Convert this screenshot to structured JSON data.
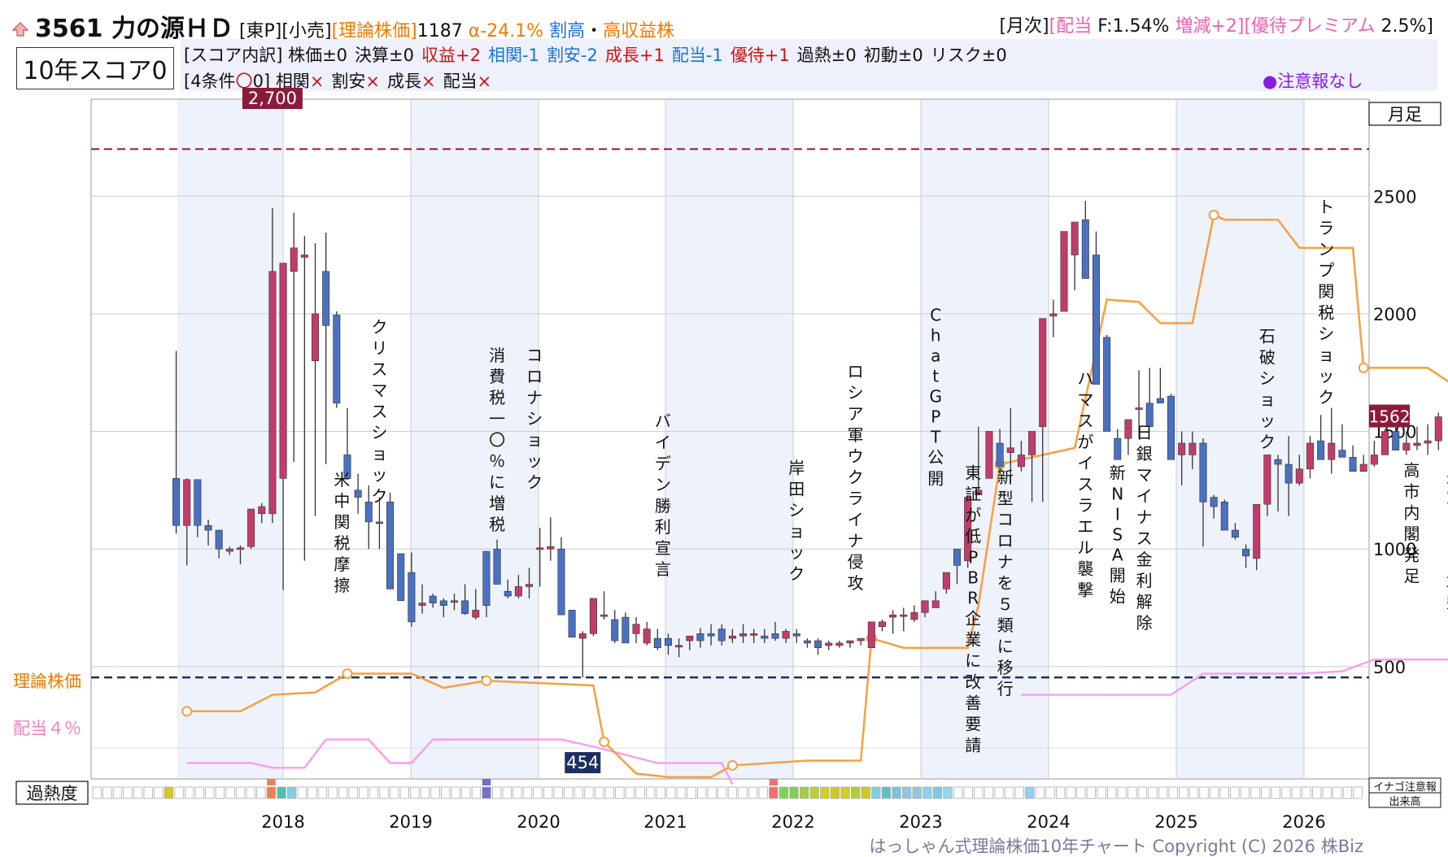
{
  "header": {
    "up_icon": "up-arrow-icon",
    "code_name": "3561 力の源ＨＤ",
    "market": "[東P][小売]",
    "theory_label": "[理論株価]",
    "theory_value": "1187",
    "alpha": "α-24.1%",
    "tag_overvalued": "割高",
    "tag_dot": "・",
    "tag_high_profit": "高収益株",
    "monthly": "[月次]",
    "div_label": "[配当",
    "div_value": "F:1.54%",
    "div_change": "増減+2]",
    "yutai_label": "[優待プレミアム",
    "yutai_value": "2.5%]"
  },
  "score": {
    "title": "10年スコア0",
    "breakdown_prefix": "[スコア内訳]",
    "items": [
      {
        "label": "株価±0",
        "color": "#111111"
      },
      {
        "label": "決算±0",
        "color": "#111111"
      },
      {
        "label": "収益+2",
        "color": "#d01010"
      },
      {
        "label": "相関-1",
        "color": "#1a73d6"
      },
      {
        "label": "割安-2",
        "color": "#1a73d6"
      },
      {
        "label": "成長+1",
        "color": "#d01010"
      },
      {
        "label": "配当-1",
        "color": "#1a73d6"
      },
      {
        "label": "優待+1",
        "color": "#d01010"
      },
      {
        "label": "過熱±0",
        "color": "#111111"
      },
      {
        "label": "初動±0",
        "color": "#111111"
      },
      {
        "label": "リスク±0",
        "color": "#111111"
      }
    ],
    "cond_prefix": "[4条件",
    "cond_circle": "〇",
    "cond_count": "0]",
    "conditions": [
      "相関",
      "割安",
      "成長",
      "配当"
    ],
    "cross": "×",
    "notice": "●注意報なし"
  },
  "chart_data": {
    "type": "candlestick",
    "period": "月足",
    "y_ticks": [
      500,
      1000,
      1500,
      2000,
      2500
    ],
    "x_ticks": [
      "2018",
      "2019",
      "2020",
      "2021",
      "2022",
      "2023",
      "2024",
      "2025",
      "2026"
    ],
    "high_label": "2,700",
    "low_label": "454",
    "last_label": "1562",
    "high_line": 2700,
    "low_line": 454,
    "series_labels": {
      "theory": "理論株価",
      "dividend": "配当４％"
    },
    "colors": {
      "up": "#c23c6a",
      "down": "#4a70c0",
      "theory": "#f5a040",
      "dividend": "#f7a0f0",
      "high_line": "#8b1a3a",
      "low_line": "#1c2f60"
    },
    "candles": [
      [
        1,
        1300,
        1842,
        1065,
        1100
      ],
      [
        2,
        1100,
        1300,
        930,
        1295
      ],
      [
        3,
        1295,
        1295,
        1050,
        1100
      ],
      [
        4,
        1100,
        1125,
        1015,
        1080
      ],
      [
        5,
        1080,
        1080,
        960,
        1000
      ],
      [
        6,
        990,
        1010,
        975,
        1000
      ],
      [
        7,
        1005,
        1015,
        935,
        1005
      ],
      [
        8,
        1010,
        1160,
        1000,
        1170
      ],
      [
        9,
        1150,
        1195,
        1110,
        1180
      ],
      [
        10,
        1150,
        2450,
        1110,
        2180
      ],
      [
        11,
        1300,
        2200,
        825,
        2215
      ],
      [
        12,
        2180,
        2430,
        1370,
        2280
      ],
      [
        13,
        2240,
        2330,
        950,
        2250
      ],
      [
        14,
        1800,
        2300,
        1140,
        2000
      ],
      [
        15,
        2180,
        2345,
        1360,
        1950
      ],
      [
        16,
        1995,
        2010,
        1600,
        1620
      ],
      [
        17,
        1400,
        1600,
        1400,
        1300
      ],
      [
        18,
        1250,
        1320,
        1150,
        1220
      ],
      [
        19,
        1200,
        1270,
        1000,
        1115
      ],
      [
        20,
        1115,
        1220,
        1000,
        1110
      ],
      [
        21,
        1200,
        1240,
        850,
        830
      ],
      [
        22,
        980,
        980,
        950,
        780
      ],
      [
        23,
        900,
        985,
        670,
        690
      ],
      [
        24,
        760,
        850,
        725,
        770
      ],
      [
        25,
        800,
        810,
        750,
        770
      ],
      [
        26,
        780,
        790,
        710,
        760
      ],
      [
        27,
        780,
        810,
        740,
        780
      ],
      [
        28,
        780,
        850,
        720,
        725
      ],
      [
        29,
        710,
        830,
        700,
        740
      ],
      [
        30,
        990,
        990,
        710,
        760
      ],
      [
        31,
        1000,
        1040,
        900,
        850
      ],
      [
        32,
        820,
        870,
        790,
        800
      ],
      [
        33,
        800,
        890,
        790,
        840
      ],
      [
        34,
        840,
        920,
        790,
        850
      ],
      [
        35,
        1000,
        1090,
        840,
        1005
      ],
      [
        36,
        1000,
        1135,
        950,
        1010
      ],
      [
        37,
        1000,
        1050,
        720,
        720
      ],
      [
        38,
        740,
        740,
        655,
        625
      ],
      [
        39,
        620,
        650,
        454,
        640
      ],
      [
        40,
        640,
        785,
        630,
        790
      ],
      [
        41,
        720,
        820,
        700,
        720
      ],
      [
        42,
        700,
        740,
        600,
        610
      ],
      [
        43,
        710,
        730,
        600,
        600
      ],
      [
        44,
        640,
        710,
        600,
        680
      ],
      [
        45,
        600,
        690,
        590,
        660
      ],
      [
        46,
        620,
        660,
        570,
        580
      ],
      [
        47,
        620,
        640,
        550,
        590
      ],
      [
        48,
        590,
        620,
        540,
        590
      ],
      [
        49,
        610,
        630,
        570,
        630
      ],
      [
        50,
        640,
        665,
        580,
        610
      ],
      [
        51,
        640,
        680,
        590,
        630
      ],
      [
        52,
        660,
        680,
        590,
        610
      ],
      [
        53,
        620,
        660,
        600,
        630
      ],
      [
        54,
        630,
        680,
        600,
        640
      ],
      [
        55,
        640,
        660,
        600,
        640
      ],
      [
        56,
        630,
        660,
        600,
        620
      ],
      [
        57,
        640,
        690,
        610,
        620
      ],
      [
        58,
        620,
        660,
        600,
        650
      ],
      [
        59,
        640,
        660,
        600,
        630
      ],
      [
        60,
        610,
        620,
        580,
        600
      ],
      [
        61,
        610,
        620,
        550,
        580
      ],
      [
        62,
        590,
        610,
        570,
        600
      ],
      [
        63,
        590,
        610,
        580,
        600
      ],
      [
        64,
        600,
        610,
        580,
        610
      ],
      [
        65,
        610,
        620,
        590,
        620
      ],
      [
        66,
        580,
        690,
        580,
        690
      ],
      [
        67,
        670,
        700,
        650,
        690
      ],
      [
        68,
        710,
        740,
        640,
        720
      ],
      [
        69,
        720,
        750,
        650,
        720
      ],
      [
        70,
        700,
        760,
        690,
        730
      ],
      [
        71,
        730,
        780,
        710,
        780
      ],
      [
        72,
        750,
        820,
        750,
        780
      ],
      [
        73,
        830,
        880,
        810,
        900
      ],
      [
        74,
        1000,
        1000,
        850,
        930
      ],
      [
        75,
        950,
        970,
        920,
        1220
      ],
      [
        76,
        1230,
        1520,
        1230,
        1250
      ],
      [
        77,
        1300,
        1430,
        1320,
        1500
      ],
      [
        78,
        1450,
        1510,
        1330,
        1350
      ],
      [
        79,
        1410,
        1600,
        1280,
        1430
      ],
      [
        80,
        1350,
        1460,
        1330,
        1400
      ],
      [
        81,
        1400,
        1500,
        1200,
        1500
      ],
      [
        82,
        1520,
        1530,
        1200,
        1980
      ],
      [
        83,
        1990,
        2060,
        1900,
        2000
      ],
      [
        84,
        2010,
        2080,
        2030,
        2350
      ],
      [
        85,
        2250,
        2310,
        2100,
        2390
      ],
      [
        86,
        2400,
        2480,
        2200,
        2150
      ],
      [
        87,
        2250,
        2350,
        1850,
        1700
      ],
      [
        88,
        1900,
        1910,
        1650,
        1500
      ],
      [
        89,
        1470,
        1510,
        1400,
        1380
      ],
      [
        90,
        1470,
        1520,
        1400,
        1550
      ],
      [
        91,
        1600,
        1760,
        1470,
        1600
      ],
      [
        92,
        1620,
        1770,
        1550,
        1520
      ],
      [
        93,
        1640,
        1770,
        1630,
        1620
      ],
      [
        94,
        1650,
        1660,
        1500,
        1380
      ],
      [
        95,
        1400,
        1500,
        1270,
        1450
      ],
      [
        96,
        1400,
        1500,
        1340,
        1450
      ],
      [
        97,
        1450,
        1470,
        1010,
        1200
      ],
      [
        98,
        1220,
        1230,
        1130,
        1180
      ],
      [
        99,
        1200,
        1210,
        1100,
        1080
      ],
      [
        100,
        1080,
        1110,
        1040,
        1050
      ],
      [
        101,
        1000,
        1020,
        920,
        970
      ],
      [
        102,
        960,
        1190,
        910,
        1190
      ],
      [
        103,
        1190,
        1400,
        1140,
        1400
      ],
      [
        104,
        1380,
        1400,
        1160,
        1360
      ],
      [
        105,
        1360,
        1480,
        1140,
        1280
      ],
      [
        106,
        1280,
        1400,
        1270,
        1340
      ],
      [
        107,
        1340,
        1480,
        1300,
        1450
      ],
      [
        108,
        1460,
        1570,
        1400,
        1380
      ],
      [
        109,
        1380,
        1600,
        1320,
        1450
      ],
      [
        110,
        1420,
        1530,
        1420,
        1390
      ],
      [
        111,
        1390,
        1440,
        1380,
        1330
      ],
      [
        112,
        1330,
        1400,
        1330,
        1360
      ],
      [
        113,
        1360,
        1460,
        1350,
        1400
      ],
      [
        114,
        1400,
        1510,
        1440,
        1500
      ],
      [
        115,
        1500,
        1560,
        1460,
        1420
      ],
      [
        116,
        1420,
        1500,
        1400,
        1450
      ],
      [
        117,
        1440,
        1520,
        1420,
        1450
      ],
      [
        118,
        1450,
        1530,
        1400,
        1460
      ],
      [
        119,
        1460,
        1580,
        1420,
        1562
      ]
    ],
    "theory_line": [
      [
        2,
        310
      ],
      [
        7,
        310
      ],
      [
        10,
        380
      ],
      [
        14,
        390
      ],
      [
        17,
        470
      ],
      [
        23,
        470
      ],
      [
        26,
        410
      ],
      [
        30,
        440
      ],
      [
        40,
        420
      ],
      [
        41,
        180
      ],
      [
        44,
        45
      ],
      [
        47,
        30
      ],
      [
        51,
        30
      ],
      [
        53,
        80
      ],
      [
        60,
        100
      ],
      [
        65,
        100
      ],
      [
        66,
        620
      ],
      [
        69,
        580
      ],
      [
        75,
        580
      ],
      [
        76,
        760
      ],
      [
        78,
        1360
      ],
      [
        83,
        1410
      ],
      [
        85,
        1430
      ],
      [
        88,
        2060
      ],
      [
        91,
        2050
      ],
      [
        93,
        1960
      ],
      [
        96,
        1960
      ],
      [
        98,
        2420
      ],
      [
        99,
        2400
      ],
      [
        104,
        2400
      ],
      [
        106,
        2280
      ],
      [
        111,
        2280
      ],
      [
        112,
        1770
      ],
      [
        118,
        1770
      ],
      [
        121,
        1680
      ],
      [
        123,
        1670
      ],
      [
        124,
        1180
      ]
    ],
    "dividend_line": [
      [
        2,
        90
      ],
      [
        8,
        90
      ],
      [
        10,
        70
      ],
      [
        13,
        70
      ],
      [
        15,
        190
      ],
      [
        19,
        190
      ],
      [
        21,
        90
      ],
      [
        23,
        90
      ],
      [
        25,
        190
      ],
      [
        36,
        190
      ],
      [
        37,
        190
      ],
      [
        40,
        160
      ],
      [
        46,
        90
      ],
      [
        52,
        90
      ],
      [
        53,
        0
      ]
    ],
    "dividend_line2": [
      [
        80,
        380
      ],
      [
        88,
        380
      ],
      [
        94,
        380
      ],
      [
        97,
        470
      ],
      [
        106,
        470
      ],
      [
        110,
        480
      ],
      [
        113,
        530
      ],
      [
        116,
        530
      ],
      [
        120,
        530
      ],
      [
        122,
        530
      ],
      [
        123,
        620
      ],
      [
        125,
        620
      ]
    ],
    "events": [
      {
        "x": 16.5,
        "top": 1270,
        "text": "米中関税摩擦"
      },
      {
        "x": 20,
        "top": 1920,
        "text": "クリスマスショック"
      },
      {
        "x": 31,
        "top": 1800,
        "text": "消費税一〇％に増税"
      },
      {
        "x": 34.5,
        "top": 1800,
        "text": "コロナショック"
      },
      {
        "x": 46.5,
        "top": 1520,
        "text": "バイデン勝利宣言"
      },
      {
        "x": 59,
        "top": 1320,
        "text": "岸田ショック"
      },
      {
        "x": 64.5,
        "top": 1730,
        "text": "ロシア軍ウクライナ侵攻"
      },
      {
        "x": 72,
        "top": 1970,
        "text": "ChatGPT公開"
      },
      {
        "x": 75.5,
        "top": 1300,
        "text": "東証が低PBR企業に改善要請"
      },
      {
        "x": 78.5,
        "top": 1280,
        "text": "新型コロナを５類に移行"
      },
      {
        "x": 86,
        "top": 1700,
        "text": "ハマスがイスラエル襲撃"
      },
      {
        "x": 89,
        "top": 1300,
        "text": "新NISA開始"
      },
      {
        "x": 91.5,
        "top": 1470,
        "text": "日銀マイナス金利解除"
      },
      {
        "x": 103,
        "top": 1880,
        "text": "石破ショック"
      },
      {
        "x": 108.5,
        "top": 2430,
        "text": "トランプ関税ショック"
      },
      {
        "x": 116.5,
        "top": 1310,
        "text": "高市内閣発足"
      },
      {
        "x": 120.5,
        "top": 1280,
        "text": "米軍イラン攻撃"
      }
    ],
    "heat_label": "過熱度",
    "heat_cells": {
      "7": "#d8c820",
      "17": "#f08050",
      "18": "#50c0b0",
      "19": "#80d0e0",
      "38": "#7070d0",
      "66": "#f07070",
      "67": "#80d050",
      "68": "#80d050",
      "69": "#a0d040",
      "70": "#c0d030",
      "71": "#d0d020",
      "72": "#d0c820",
      "73": "#d0d020",
      "74": "#b0d030",
      "75": "#d0c820",
      "76": "#80d0e0",
      "77": "#60c0c0",
      "78": "#80c0e0",
      "79": "#90c8e0",
      "80": "#90c8e0",
      "81": "#90d0f0",
      "82": "#80c8e0",
      "83": "#90d8f0",
      "91": "#90d0f0"
    },
    "side_labels": {
      "period": "月足",
      "inago": "イナゴ注意報",
      "volume": "出来高"
    }
  },
  "footer": {
    "copyright": "はっしゃん式理論株価10年チャート Copyright (C) 2026 株Biz"
  }
}
